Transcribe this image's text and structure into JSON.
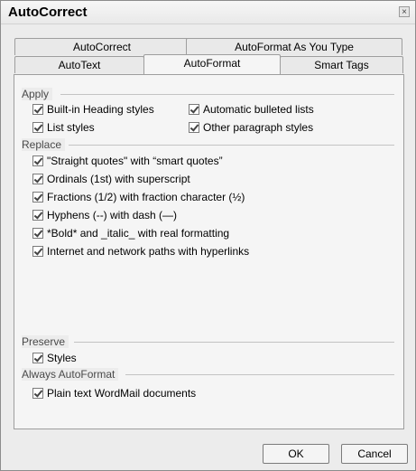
{
  "window": {
    "title": "AutoCorrect",
    "close_glyph": "×"
  },
  "tabs": {
    "row1": [
      "AutoCorrect",
      "AutoFormat As You Type"
    ],
    "row2": [
      "AutoText",
      "AutoFormat",
      "Smart Tags"
    ],
    "active": "AutoFormat"
  },
  "sections": {
    "apply": {
      "label": "Apply",
      "options": [
        {
          "label": "Built-in Heading styles",
          "checked": true
        },
        {
          "label": "Automatic bulleted lists",
          "checked": true
        },
        {
          "label": "List styles",
          "checked": true
        },
        {
          "label": "Other paragraph styles",
          "checked": true
        }
      ]
    },
    "replace": {
      "label": "Replace",
      "options": [
        {
          "label": "\"Straight quotes\" with “smart quotes”",
          "checked": true
        },
        {
          "label": "Ordinals (1st) with superscript",
          "checked": true
        },
        {
          "label": "Fractions (1/2) with fraction character (½)",
          "checked": true
        },
        {
          "label": "Hyphens (--) with dash (—)",
          "checked": true
        },
        {
          "label": "*Bold* and _italic_ with real formatting",
          "checked": true
        },
        {
          "label": "Internet and network paths with hyperlinks",
          "checked": true
        }
      ]
    },
    "preserve": {
      "label": "Preserve",
      "options": [
        {
          "label": "Styles",
          "checked": true
        }
      ]
    },
    "always": {
      "label": "Always AutoFormat",
      "options": [
        {
          "label": "Plain text WordMail documents",
          "checked": true
        }
      ]
    }
  },
  "buttons": {
    "ok": "OK",
    "cancel": "Cancel"
  }
}
